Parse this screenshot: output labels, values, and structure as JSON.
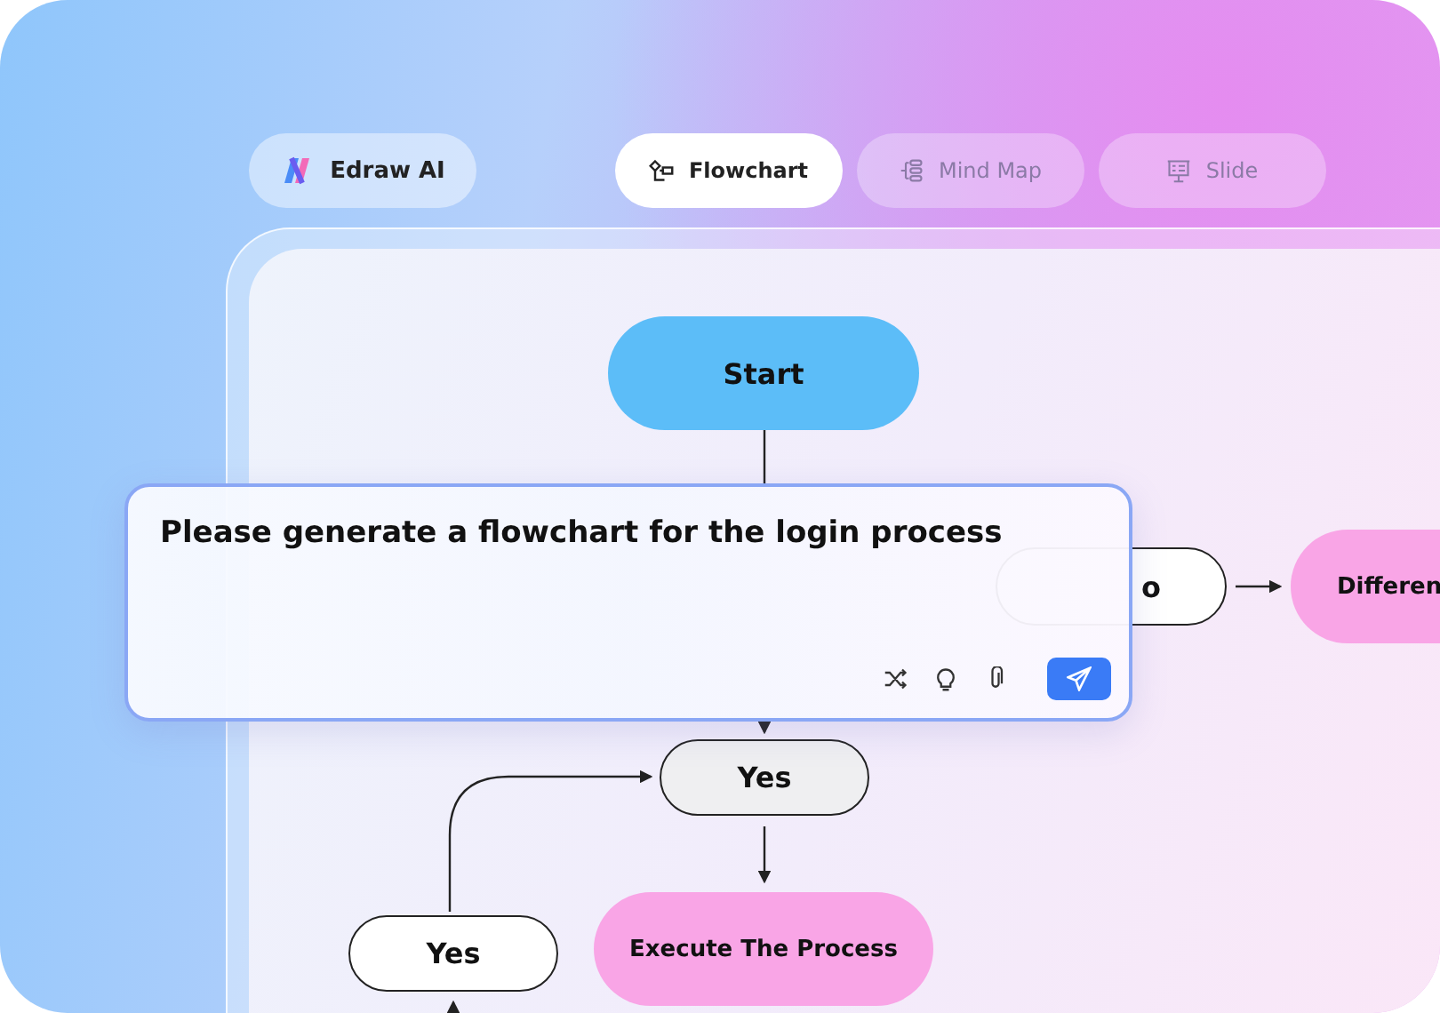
{
  "brand": {
    "label": "Edraw AI"
  },
  "tabs": [
    {
      "label": "Flowchart",
      "kind": "flowchart",
      "selected": true
    },
    {
      "label": "Mind Map",
      "kind": "mindmap",
      "selected": false
    },
    {
      "label": "Slide",
      "kind": "slide",
      "selected": false
    }
  ],
  "flowchart": {
    "nodes": [
      {
        "label": "Start",
        "color": "#5cbdf8"
      },
      {
        "label": "o",
        "color": "#ffffff"
      },
      {
        "label": "Differen",
        "color": "#f9a5e6"
      },
      {
        "label": "Yes",
        "color": "#efeff1"
      },
      {
        "label": "Yes",
        "color": "#ffffff"
      },
      {
        "label": "Execute The Process",
        "color": "#f9a5e6"
      }
    ]
  },
  "prompt": {
    "value": "Please generate a flowchart for the login process"
  }
}
